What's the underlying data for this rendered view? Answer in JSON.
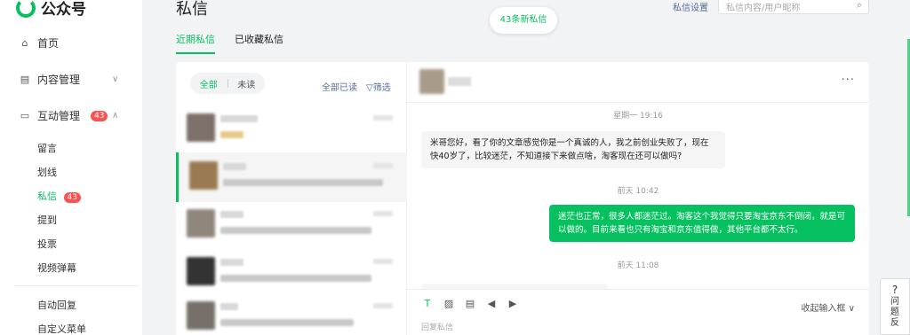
{
  "brand": {
    "name": "公众号"
  },
  "sidebar": {
    "items": [
      {
        "label": "首页",
        "icon": "home-icon"
      },
      {
        "label": "内容管理",
        "icon": "document-icon"
      },
      {
        "label": "互动管理",
        "icon": "message-icon",
        "badge": "43"
      }
    ],
    "sub_items": [
      {
        "label": "留言"
      },
      {
        "label": "划线"
      },
      {
        "label": "私信",
        "badge": "43",
        "active": true
      },
      {
        "label": "提到"
      },
      {
        "label": "投票"
      },
      {
        "label": "视频弹幕"
      }
    ],
    "extra_items": [
      {
        "label": "自动回复"
      },
      {
        "label": "自定义菜单"
      }
    ]
  },
  "header": {
    "title": "私信",
    "settings_link": "私信设置",
    "search_placeholder": "私信内容/用户昵称",
    "new_messages": "43条新私信"
  },
  "tabs": [
    {
      "label": "近期私信",
      "active": true
    },
    {
      "label": "已收藏私信",
      "active": false
    }
  ],
  "list": {
    "filter_all": "全部",
    "filter_unread": "未读",
    "mark_all_read": "全部已读",
    "filter_button": "筛选"
  },
  "chat": {
    "messages": [
      {
        "time": "星期一 19:16",
        "direction": "in",
        "text": "米哥您好，看了你的文章感觉你是一个真诚的人，我之前创业失败了，现在快40岁了，比较迷茫，不知道接下来做点啥，淘客现在还可以做吗?"
      },
      {
        "time": "前天 10:42",
        "direction": "out",
        "text": "迷茫也正常，很多人都迷茫过。淘客这个我觉得只要淘宝京东不倒闭，就是可以做的。目前来看也只有淘宝和京东值得做，其他平台都不太行。"
      },
      {
        "time": "前天 11:08",
        "direction": "in",
        "text": ""
      }
    ],
    "collapse_label": "收起输入框",
    "input_placeholder": "回复私信"
  },
  "help": {
    "label": "问题反"
  },
  "colors": {
    "accent": "#07c160",
    "badge": "#fa5151",
    "link": "#576b95"
  }
}
